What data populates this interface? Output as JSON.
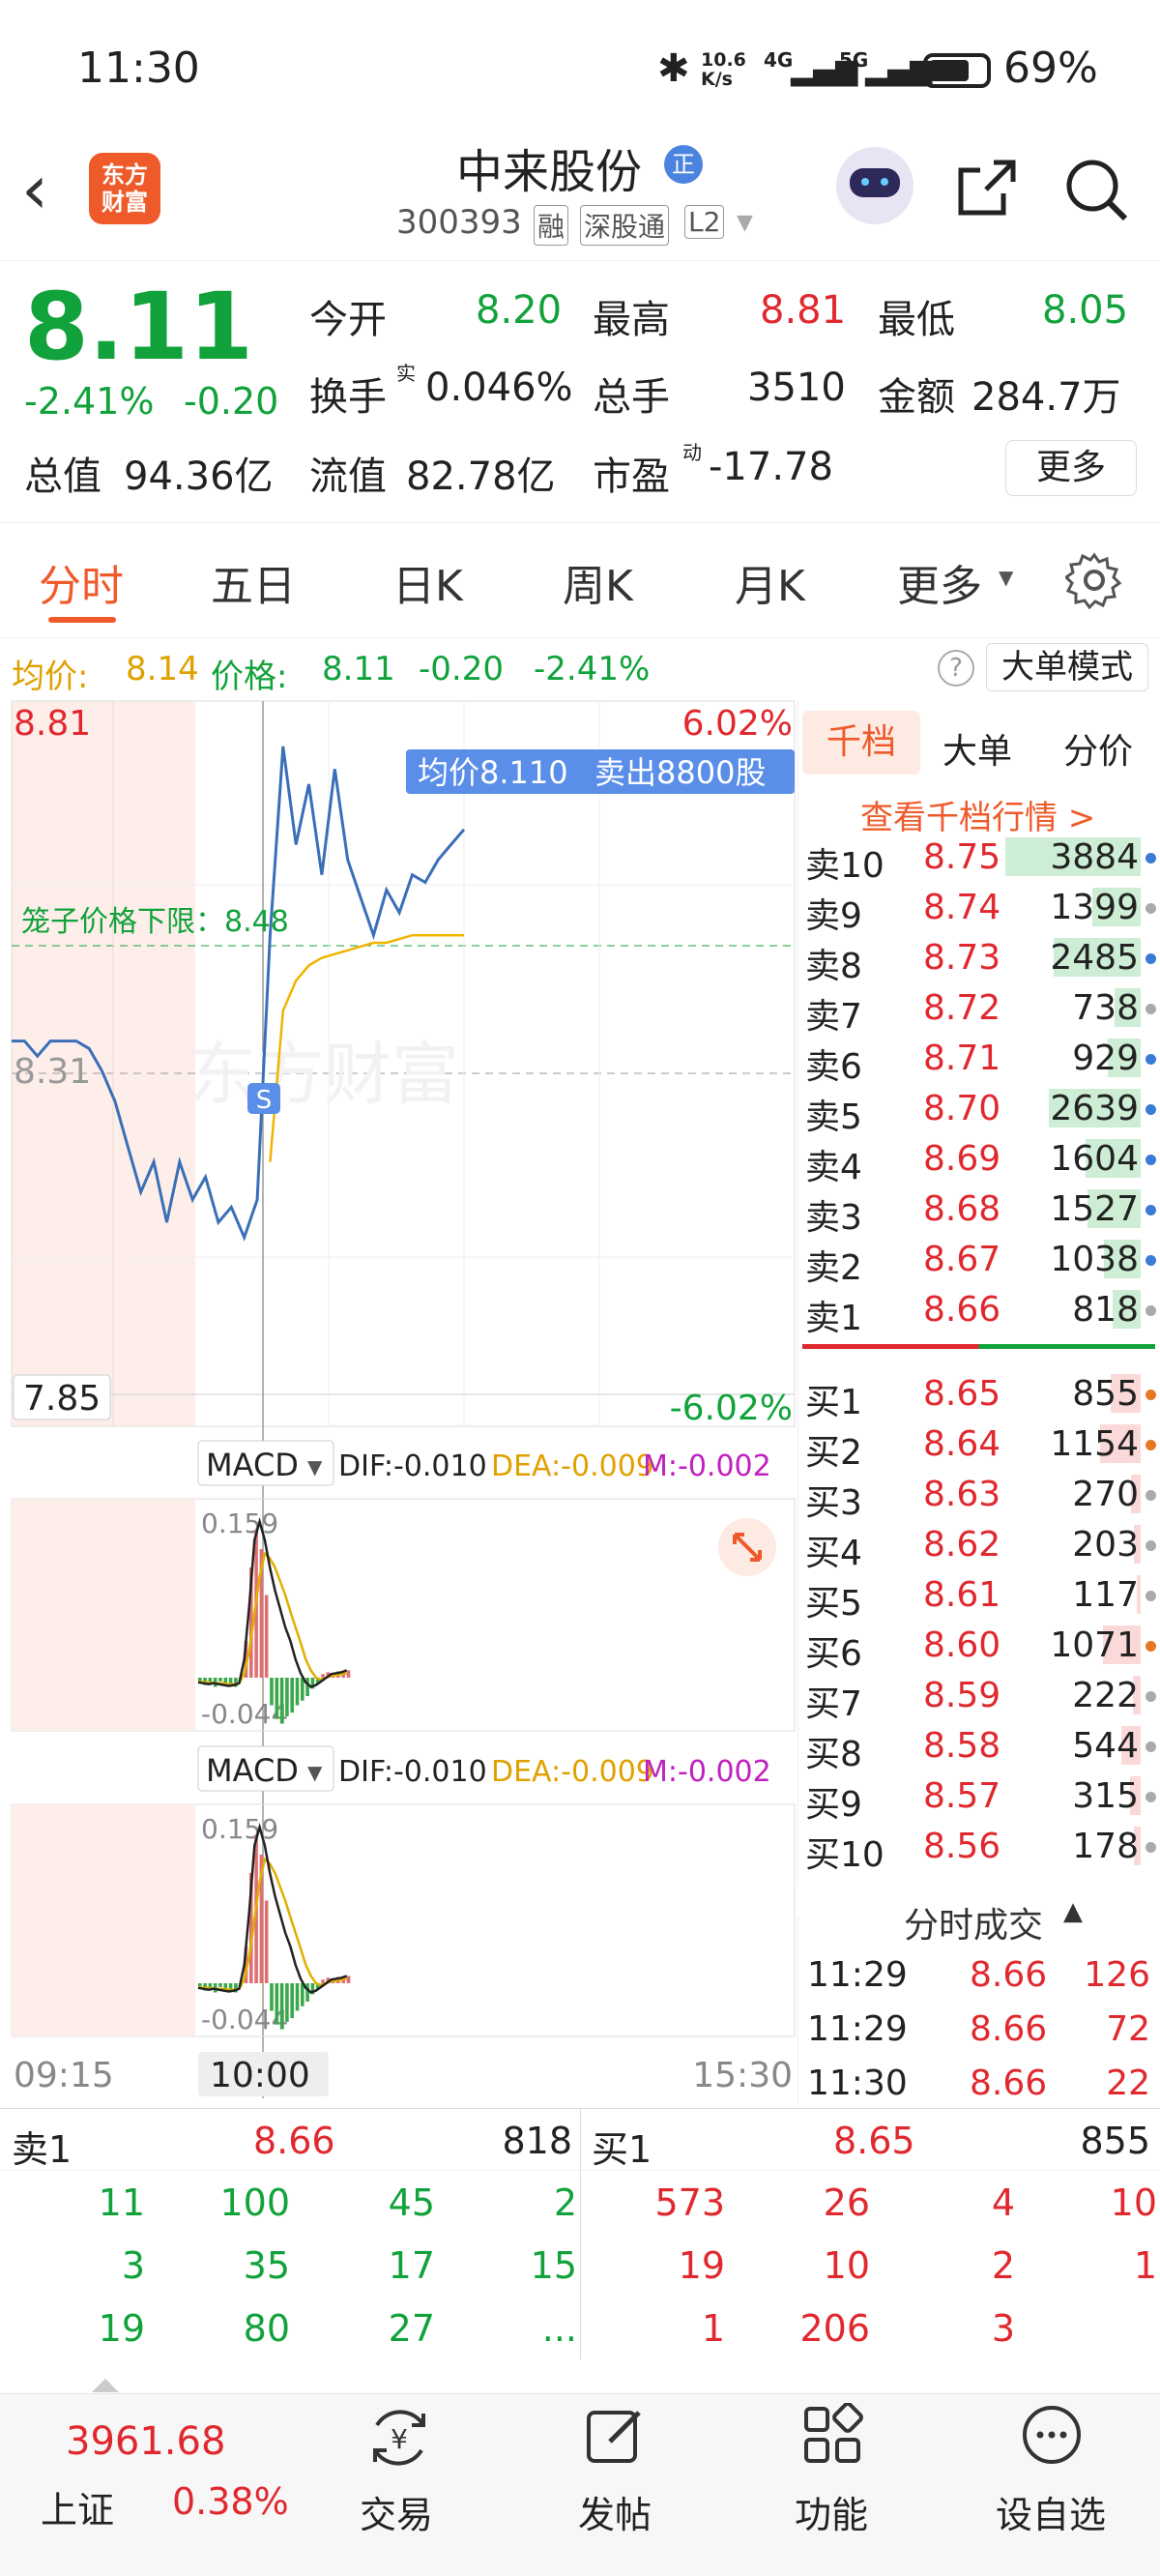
{
  "status": {
    "time": "11:30",
    "net_speed": "10.6\nK/s",
    "net_a": "4G",
    "net_b": "5G",
    "battery": "69%"
  },
  "header": {
    "logo_text": "东方\n财富",
    "stock_name": "中来股份",
    "name_badge": "正",
    "stock_code": "300393",
    "tags": [
      "融",
      "深股通",
      "L2"
    ]
  },
  "quote": {
    "price": "8.11",
    "change_pct": "-2.41%",
    "change": "-0.20",
    "open_label": "今开",
    "open": "8.20",
    "high_label": "最高",
    "high": "8.81",
    "low_label": "最低",
    "low": "8.05",
    "turnover_label": "换手",
    "turnover_sup": "实",
    "turnover": "0.046%",
    "volume_label": "总手",
    "volume": "3510",
    "amount_label": "金额",
    "amount": "284.7万",
    "mcap_label": "总值",
    "mcap": "94.36亿",
    "float_label": "流值",
    "float_mcap": "82.78亿",
    "pe_label": "市盈",
    "pe_sup": "动",
    "pe": "-17.78",
    "more_btn": "更多"
  },
  "tabs": [
    "分时",
    "五日",
    "日K",
    "周K",
    "月K",
    "更多"
  ],
  "info_line": {
    "avg_label": "均价:",
    "avg": "8.14",
    "price_label": "价格:",
    "price": "8.11",
    "chg": "-0.20",
    "pct": "-2.41%",
    "mode_btn": "大单模式"
  },
  "chart": {
    "y_top": "8.81",
    "y_mid": "8.31",
    "y_bot": "7.85",
    "pct_top": "6.02%",
    "pct_bot": "-6.02%",
    "cage_label": "笼子价格下限：8.48",
    "tooltip_avg": "均价8.110",
    "tooltip_sell": "卖出8800股",
    "s_marker": "S",
    "watermark": "东方财富",
    "time_start": "09:15",
    "time_cursor": "10:00",
    "time_end": "15:30"
  },
  "chart_data": {
    "type": "line",
    "title": "",
    "xlabel": "",
    "ylabel": "",
    "ylim": [
      7.85,
      8.81
    ],
    "x_ticks": [
      "09:15",
      "10:00",
      "15:30"
    ],
    "series": [
      {
        "name": "价格",
        "values": [
          8.36,
          8.36,
          8.34,
          8.36,
          8.36,
          8.36,
          8.35,
          8.32,
          8.28,
          8.22,
          8.16,
          8.2,
          8.12,
          8.2,
          8.15,
          8.18,
          8.12,
          8.14,
          8.1,
          8.15,
          8.5,
          8.75,
          8.62,
          8.7,
          8.58,
          8.72,
          8.6,
          8.55,
          8.5,
          8.56,
          8.53,
          8.58,
          8.57,
          8.6,
          8.62,
          8.64
        ]
      },
      {
        "name": "均价",
        "values": [
          null,
          null,
          null,
          null,
          null,
          null,
          null,
          null,
          null,
          null,
          null,
          null,
          null,
          null,
          null,
          null,
          null,
          null,
          null,
          null,
          8.2,
          8.4,
          8.44,
          8.46,
          8.47,
          8.475,
          8.48,
          8.485,
          8.49,
          8.49,
          8.495,
          8.5,
          8.5,
          8.5,
          8.5,
          8.5
        ]
      }
    ],
    "macd": {
      "label": "MACD",
      "dif": "DIF:-0.010",
      "dea": "DEA:-0.009",
      "m": "M:-0.002",
      "top": "0.159",
      "bottom": "-0.044"
    }
  },
  "orderbook": {
    "tabs": [
      "千档",
      "大单",
      "分价"
    ],
    "link": "查看千档行情 >",
    "asks": [
      {
        "label": "卖10",
        "price": "8.75",
        "vol": "3884",
        "bar": 1.0,
        "dot": "#3a7bd5"
      },
      {
        "label": "卖9",
        "price": "8.74",
        "vol": "1399",
        "bar": 0.36,
        "dot": "#aaaaaa"
      },
      {
        "label": "卖8",
        "price": "8.73",
        "vol": "2485",
        "bar": 0.64,
        "dot": "#3a7bd5"
      },
      {
        "label": "卖7",
        "price": "8.72",
        "vol": "738",
        "bar": 0.19,
        "dot": "#aaaaaa"
      },
      {
        "label": "卖6",
        "price": "8.71",
        "vol": "929",
        "bar": 0.24,
        "dot": "#3a7bd5"
      },
      {
        "label": "卖5",
        "price": "8.70",
        "vol": "2639",
        "bar": 0.68,
        "dot": "#3a7bd5"
      },
      {
        "label": "卖4",
        "price": "8.69",
        "vol": "1604",
        "bar": 0.41,
        "dot": "#3a7bd5"
      },
      {
        "label": "卖3",
        "price": "8.68",
        "vol": "1527",
        "bar": 0.39,
        "dot": "#3a7bd5"
      },
      {
        "label": "卖2",
        "price": "8.67",
        "vol": "1038",
        "bar": 0.27,
        "dot": "#3a7bd5"
      },
      {
        "label": "卖1",
        "price": "8.66",
        "vol": "818",
        "bar": 0.21,
        "dot": "#aaaaaa"
      }
    ],
    "bids": [
      {
        "label": "买1",
        "price": "8.65",
        "vol": "855",
        "bar": 0.22,
        "dot": "#e87722"
      },
      {
        "label": "买2",
        "price": "8.64",
        "vol": "1154",
        "bar": 0.3,
        "dot": "#e87722"
      },
      {
        "label": "买3",
        "price": "8.63",
        "vol": "270",
        "bar": 0.07,
        "dot": "#aaaaaa"
      },
      {
        "label": "买4",
        "price": "8.62",
        "vol": "203",
        "bar": 0.05,
        "dot": "#aaaaaa"
      },
      {
        "label": "买5",
        "price": "8.61",
        "vol": "117",
        "bar": 0.03,
        "dot": "#aaaaaa"
      },
      {
        "label": "买6",
        "price": "8.60",
        "vol": "1071",
        "bar": 0.28,
        "dot": "#e87722"
      },
      {
        "label": "买7",
        "price": "8.59",
        "vol": "222",
        "bar": 0.06,
        "dot": "#aaaaaa"
      },
      {
        "label": "买8",
        "price": "8.58",
        "vol": "544",
        "bar": 0.14,
        "dot": "#aaaaaa"
      },
      {
        "label": "买9",
        "price": "8.57",
        "vol": "315",
        "bar": 0.08,
        "dot": "#aaaaaa"
      },
      {
        "label": "买10",
        "price": "8.56",
        "vol": "178",
        "bar": 0.05,
        "dot": "#aaaaaa"
      }
    ],
    "trades_title": "分时成交",
    "trades": [
      {
        "time": "11:29",
        "price": "8.66",
        "vol": "126"
      },
      {
        "time": "11:29",
        "price": "8.66",
        "vol": "72"
      },
      {
        "time": "11:30",
        "price": "8.66",
        "vol": "22"
      }
    ]
  },
  "queue": {
    "ask_label": "卖1",
    "ask_price": "8.66",
    "ask_vol": "818",
    "bid_label": "买1",
    "bid_price": "8.65",
    "bid_vol": "855",
    "ask_rows": [
      [
        "11",
        "100",
        "45",
        "2"
      ],
      [
        "3",
        "35",
        "17",
        "15"
      ],
      [
        "19",
        "80",
        "27",
        "..."
      ]
    ],
    "bid_rows": [
      [
        "573",
        "26",
        "4",
        "10"
      ],
      [
        "19",
        "10",
        "2",
        "1"
      ],
      [
        "1",
        "206",
        "3",
        ""
      ]
    ]
  },
  "bottom_nav": {
    "index_value": "3961.68",
    "index_name": "上证",
    "index_pct": "0.38%",
    "items": [
      "交易",
      "发帖",
      "功能",
      "设自选"
    ]
  }
}
